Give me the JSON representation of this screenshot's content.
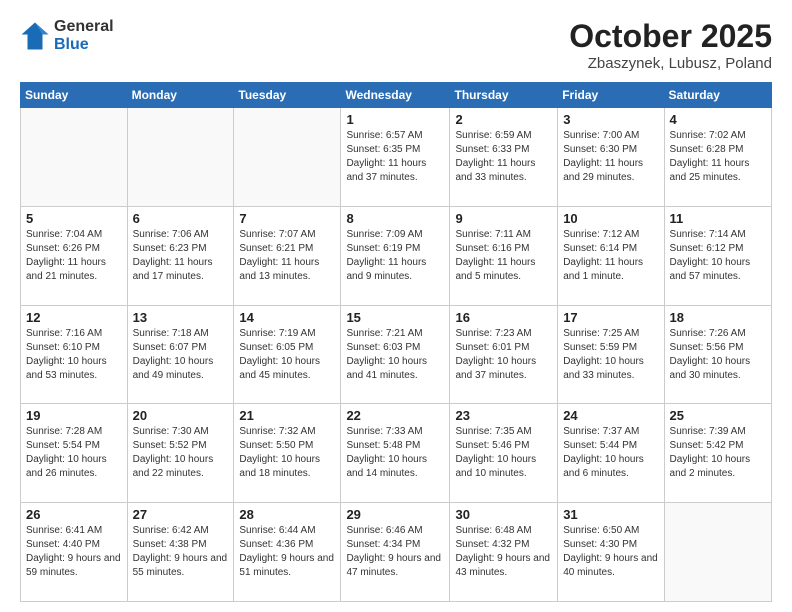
{
  "header": {
    "logo_line1": "General",
    "logo_line2": "Blue",
    "month": "October 2025",
    "location": "Zbaszynek, Lubusz, Poland"
  },
  "weekdays": [
    "Sunday",
    "Monday",
    "Tuesday",
    "Wednesday",
    "Thursday",
    "Friday",
    "Saturday"
  ],
  "weeks": [
    [
      {
        "day": "",
        "info": ""
      },
      {
        "day": "",
        "info": ""
      },
      {
        "day": "",
        "info": ""
      },
      {
        "day": "1",
        "info": "Sunrise: 6:57 AM\nSunset: 6:35 PM\nDaylight: 11 hours\nand 37 minutes."
      },
      {
        "day": "2",
        "info": "Sunrise: 6:59 AM\nSunset: 6:33 PM\nDaylight: 11 hours\nand 33 minutes."
      },
      {
        "day": "3",
        "info": "Sunrise: 7:00 AM\nSunset: 6:30 PM\nDaylight: 11 hours\nand 29 minutes."
      },
      {
        "day": "4",
        "info": "Sunrise: 7:02 AM\nSunset: 6:28 PM\nDaylight: 11 hours\nand 25 minutes."
      }
    ],
    [
      {
        "day": "5",
        "info": "Sunrise: 7:04 AM\nSunset: 6:26 PM\nDaylight: 11 hours\nand 21 minutes."
      },
      {
        "day": "6",
        "info": "Sunrise: 7:06 AM\nSunset: 6:23 PM\nDaylight: 11 hours\nand 17 minutes."
      },
      {
        "day": "7",
        "info": "Sunrise: 7:07 AM\nSunset: 6:21 PM\nDaylight: 11 hours\nand 13 minutes."
      },
      {
        "day": "8",
        "info": "Sunrise: 7:09 AM\nSunset: 6:19 PM\nDaylight: 11 hours\nand 9 minutes."
      },
      {
        "day": "9",
        "info": "Sunrise: 7:11 AM\nSunset: 6:16 PM\nDaylight: 11 hours\nand 5 minutes."
      },
      {
        "day": "10",
        "info": "Sunrise: 7:12 AM\nSunset: 6:14 PM\nDaylight: 11 hours\nand 1 minute."
      },
      {
        "day": "11",
        "info": "Sunrise: 7:14 AM\nSunset: 6:12 PM\nDaylight: 10 hours\nand 57 minutes."
      }
    ],
    [
      {
        "day": "12",
        "info": "Sunrise: 7:16 AM\nSunset: 6:10 PM\nDaylight: 10 hours\nand 53 minutes."
      },
      {
        "day": "13",
        "info": "Sunrise: 7:18 AM\nSunset: 6:07 PM\nDaylight: 10 hours\nand 49 minutes."
      },
      {
        "day": "14",
        "info": "Sunrise: 7:19 AM\nSunset: 6:05 PM\nDaylight: 10 hours\nand 45 minutes."
      },
      {
        "day": "15",
        "info": "Sunrise: 7:21 AM\nSunset: 6:03 PM\nDaylight: 10 hours\nand 41 minutes."
      },
      {
        "day": "16",
        "info": "Sunrise: 7:23 AM\nSunset: 6:01 PM\nDaylight: 10 hours\nand 37 minutes."
      },
      {
        "day": "17",
        "info": "Sunrise: 7:25 AM\nSunset: 5:59 PM\nDaylight: 10 hours\nand 33 minutes."
      },
      {
        "day": "18",
        "info": "Sunrise: 7:26 AM\nSunset: 5:56 PM\nDaylight: 10 hours\nand 30 minutes."
      }
    ],
    [
      {
        "day": "19",
        "info": "Sunrise: 7:28 AM\nSunset: 5:54 PM\nDaylight: 10 hours\nand 26 minutes."
      },
      {
        "day": "20",
        "info": "Sunrise: 7:30 AM\nSunset: 5:52 PM\nDaylight: 10 hours\nand 22 minutes."
      },
      {
        "day": "21",
        "info": "Sunrise: 7:32 AM\nSunset: 5:50 PM\nDaylight: 10 hours\nand 18 minutes."
      },
      {
        "day": "22",
        "info": "Sunrise: 7:33 AM\nSunset: 5:48 PM\nDaylight: 10 hours\nand 14 minutes."
      },
      {
        "day": "23",
        "info": "Sunrise: 7:35 AM\nSunset: 5:46 PM\nDaylight: 10 hours\nand 10 minutes."
      },
      {
        "day": "24",
        "info": "Sunrise: 7:37 AM\nSunset: 5:44 PM\nDaylight: 10 hours\nand 6 minutes."
      },
      {
        "day": "25",
        "info": "Sunrise: 7:39 AM\nSunset: 5:42 PM\nDaylight: 10 hours\nand 2 minutes."
      }
    ],
    [
      {
        "day": "26",
        "info": "Sunrise: 6:41 AM\nSunset: 4:40 PM\nDaylight: 9 hours\nand 59 minutes."
      },
      {
        "day": "27",
        "info": "Sunrise: 6:42 AM\nSunset: 4:38 PM\nDaylight: 9 hours\nand 55 minutes."
      },
      {
        "day": "28",
        "info": "Sunrise: 6:44 AM\nSunset: 4:36 PM\nDaylight: 9 hours\nand 51 minutes."
      },
      {
        "day": "29",
        "info": "Sunrise: 6:46 AM\nSunset: 4:34 PM\nDaylight: 9 hours\nand 47 minutes."
      },
      {
        "day": "30",
        "info": "Sunrise: 6:48 AM\nSunset: 4:32 PM\nDaylight: 9 hours\nand 43 minutes."
      },
      {
        "day": "31",
        "info": "Sunrise: 6:50 AM\nSunset: 4:30 PM\nDaylight: 9 hours\nand 40 minutes."
      },
      {
        "day": "",
        "info": ""
      }
    ]
  ]
}
